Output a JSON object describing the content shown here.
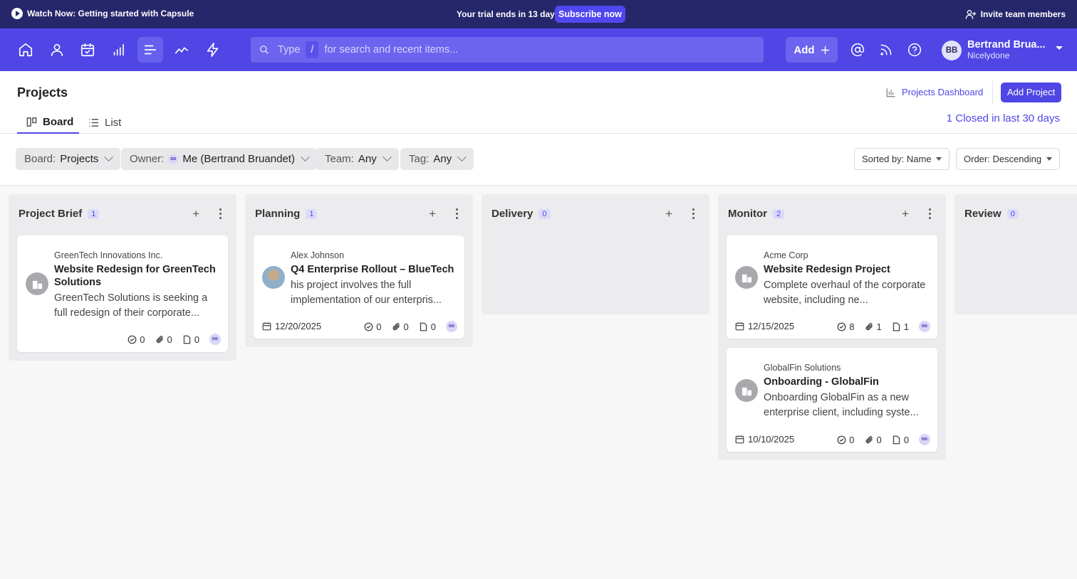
{
  "banner": {
    "watch": "Watch Now: Getting started with Capsule",
    "trial_prefix": "Your trial ends in",
    "trial_days": "13 days",
    "subscribe": "Subscribe now",
    "invite": "Invite team members"
  },
  "nav": {
    "search_prefix": "Type",
    "search_key": "/",
    "search_suffix": "for search and recent items...",
    "add_label": "Add",
    "user_name": "Bertrand Brua...",
    "user_org": "Nicelydone",
    "user_initials": "BB"
  },
  "header": {
    "title": "Projects",
    "tabs": [
      {
        "label": "Board"
      },
      {
        "label": "List"
      }
    ],
    "dashboard_link": "Projects Dashboard",
    "add_project": "Add Project",
    "closed_link": "1 Closed in last 30 days"
  },
  "filters": {
    "board": {
      "key": "Board:",
      "value": "Projects"
    },
    "owner": {
      "key": "Owner:",
      "value": "Me (Bertrand Bruandet)",
      "initials": "BB"
    },
    "team": {
      "key": "Team:",
      "value": "Any"
    },
    "tag": {
      "key": "Tag:",
      "value": "Any"
    },
    "sort": "Sorted by: Name",
    "order": "Order: Descending"
  },
  "columns": [
    {
      "title": "Project Brief",
      "count": "1",
      "cards": [
        {
          "company": "GreenTech Innovations Inc.",
          "title": "Website Redesign for GreenTech Solutions",
          "desc": "GreenTech Solutions is seeking a full redesign of their corporate...",
          "date": "",
          "tasks": "0",
          "files": "0",
          "notes": "0",
          "owner": "BB"
        }
      ]
    },
    {
      "title": "Planning",
      "count": "1",
      "cards": [
        {
          "company": "Alex Johnson",
          "title": "Q4 Enterprise Rollout – BlueTech",
          "desc": "his project involves the full implementation of our enterpris...",
          "date": "12/20/2025",
          "tasks": "0",
          "files": "0",
          "notes": "0",
          "owner": "BB"
        }
      ]
    },
    {
      "title": "Delivery",
      "count": "0",
      "cards": []
    },
    {
      "title": "Monitor",
      "count": "2",
      "cards": [
        {
          "company": "Acme Corp",
          "title": "Website Redesign Project",
          "desc": "Complete overhaul of the corporate website, including ne...",
          "date": "12/15/2025",
          "tasks": "8",
          "files": "1",
          "notes": "1",
          "owner": "BB"
        },
        {
          "company": "GlobalFin Solutions",
          "title": "Onboarding - GlobalFin",
          "desc": "Onboarding GlobalFin as a new enterprise client, including syste...",
          "date": "10/10/2025",
          "tasks": "0",
          "files": "0",
          "notes": "0",
          "owner": "BB"
        }
      ]
    },
    {
      "title": "Review",
      "count": "0",
      "cards": []
    }
  ],
  "colors": {
    "brand": "#4f46e5",
    "banner": "#26276b"
  }
}
